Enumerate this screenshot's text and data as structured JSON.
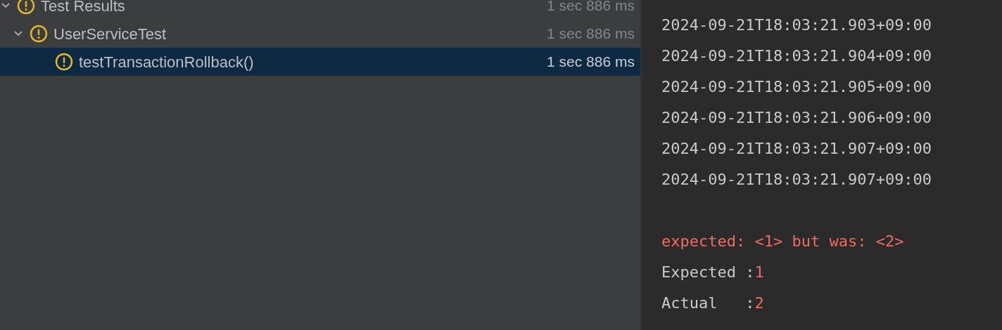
{
  "test_tree": [
    {
      "label": "Test Results",
      "time": "1 sec 886 ms",
      "kind": "warning",
      "expanded": true,
      "selected": false,
      "children": [
        {
          "label": "UserServiceTest",
          "time": "1 sec 886 ms",
          "kind": "warning",
          "expanded": true,
          "selected": false,
          "children": [
            {
              "label": "testTransactionRollback()",
              "time": "1 sec 886 ms",
              "kind": "warning",
              "selected": true
            }
          ]
        }
      ]
    }
  ],
  "console": [
    {
      "kind": "log",
      "text": "2024-09-21T18:03:21.903+09:00"
    },
    {
      "kind": "log",
      "text": "2024-09-21T18:03:21.904+09:00"
    },
    {
      "kind": "log",
      "text": "2024-09-21T18:03:21.905+09:00"
    },
    {
      "kind": "log",
      "text": "2024-09-21T18:03:21.906+09:00"
    },
    {
      "kind": "log",
      "text": "2024-09-21T18:03:21.907+09:00"
    },
    {
      "kind": "log",
      "text": "2024-09-21T18:03:21.907+09:00"
    },
    {
      "kind": "blank"
    },
    {
      "kind": "error",
      "text": "expected: <1> but was: <2>"
    },
    {
      "kind": "compare",
      "label": "Expected :",
      "value": "1"
    },
    {
      "kind": "compare",
      "label": "Actual   :",
      "value": "2"
    }
  ]
}
